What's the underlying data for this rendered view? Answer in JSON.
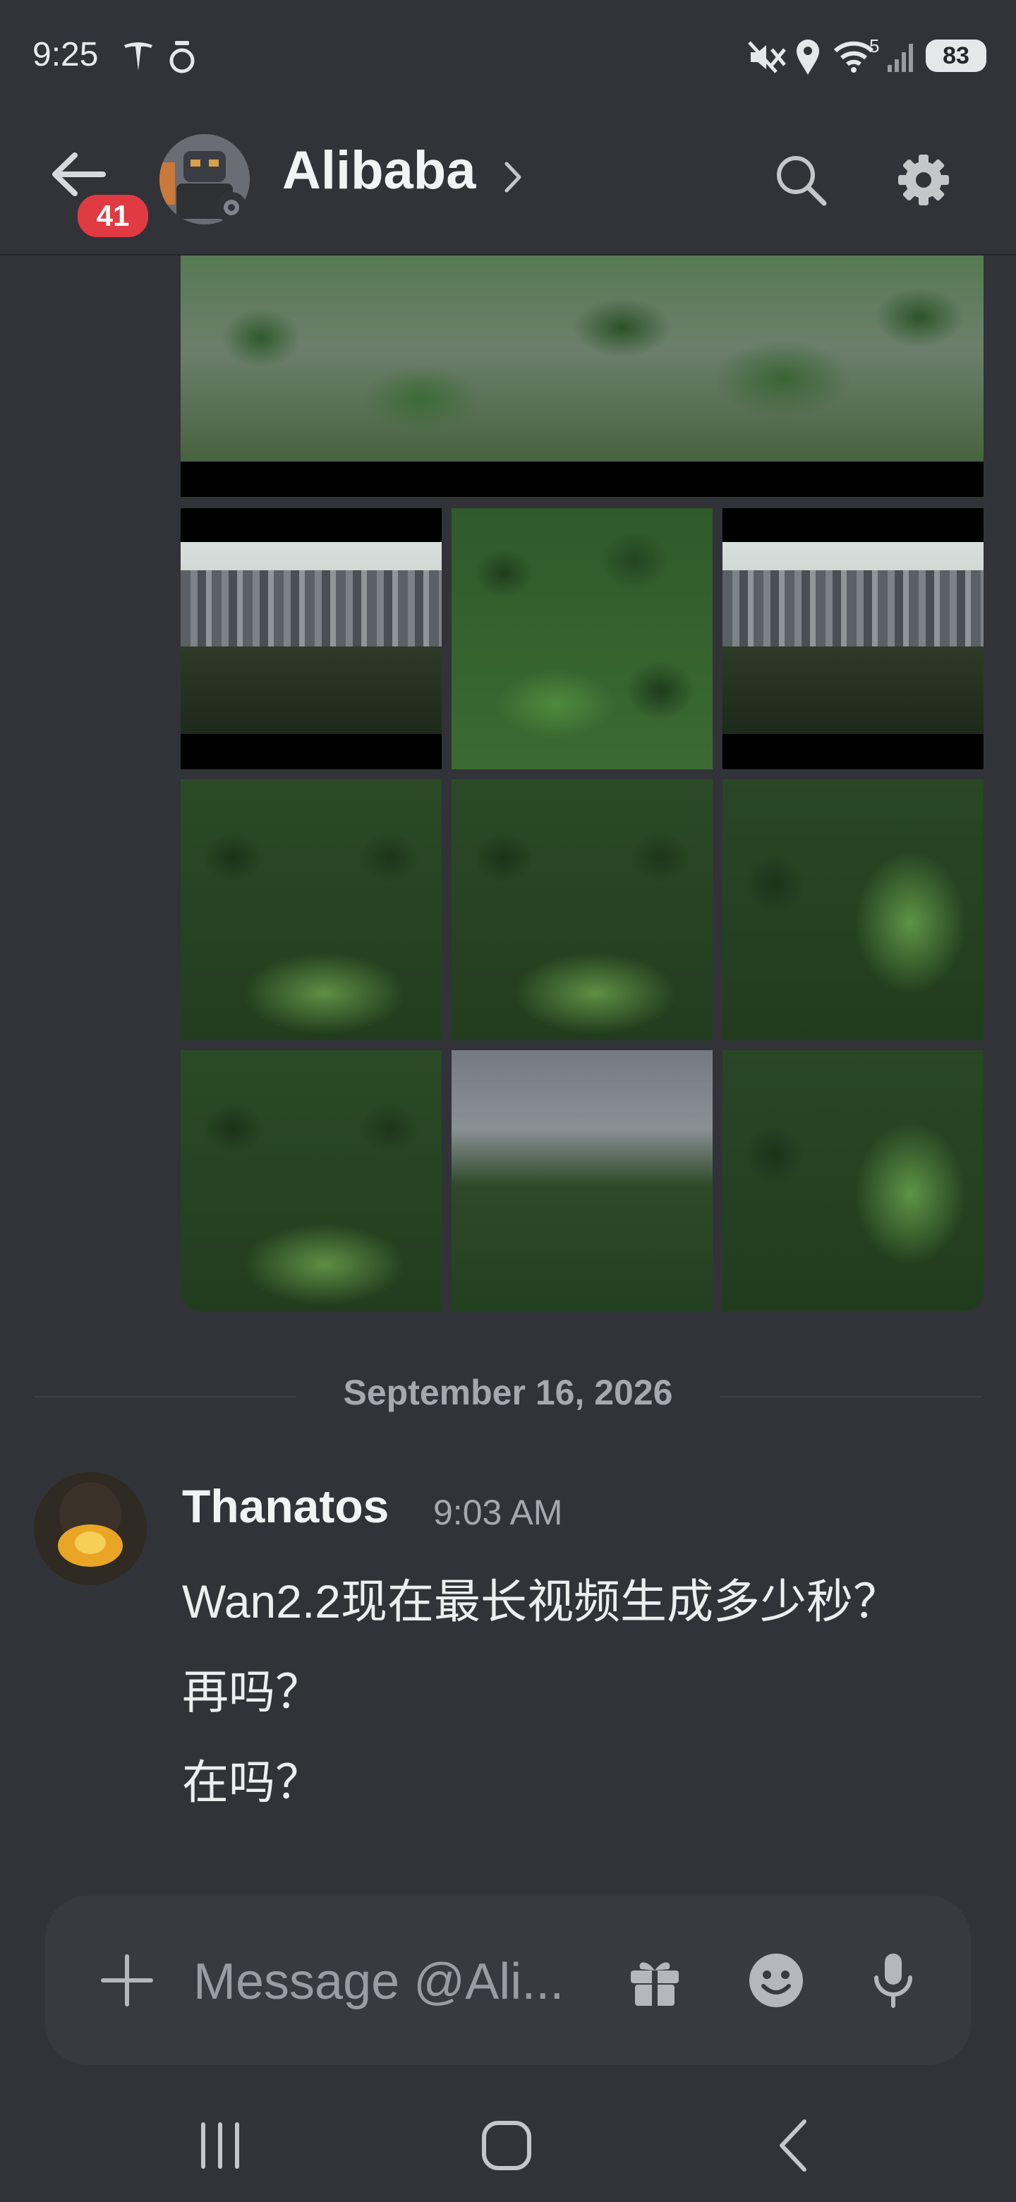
{
  "status_bar": {
    "time": "9:25",
    "signal_superscript": "5",
    "battery": "83"
  },
  "header": {
    "unread_count": "41",
    "title": "Alibaba"
  },
  "date_divider": "September 16, 2026",
  "message": {
    "author": "Thanatos",
    "time": "9:03 AM",
    "lines": [
      "Wan2.2现在最长视频生成多少秒？",
      "再吗？",
      "在吗？"
    ]
  },
  "composer": {
    "placeholder": "Message @Ali..."
  },
  "icons": {
    "back": "arrow-left-icon",
    "search": "search-icon",
    "settings": "gear-icon",
    "add": "plus-icon",
    "gift": "gift-icon",
    "emoji": "emoji-icon",
    "mic": "microphone-icon",
    "recents": "recents-icon",
    "home": "home-icon",
    "nav_back": "nav-back-icon"
  },
  "colors": {
    "background": "#313338",
    "badge": "#e03a42",
    "composer": "#383a40",
    "muted_text": "#a5a8ae"
  }
}
